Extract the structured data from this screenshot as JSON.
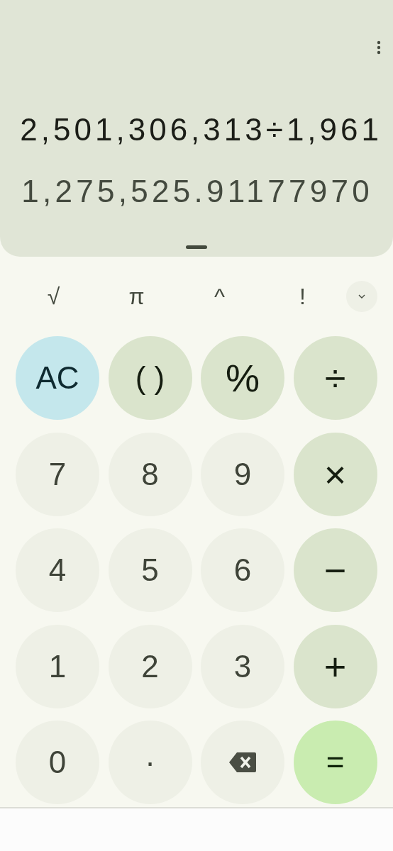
{
  "display": {
    "expression": "2,501,306,313÷1,961",
    "result": "1,275,525.91177970"
  },
  "scientific": {
    "keys": [
      "√",
      "π",
      "^",
      "!"
    ],
    "expanded": false
  },
  "keys": [
    {
      "label": "AC",
      "kind": "clear"
    },
    {
      "label": "( )",
      "kind": "function"
    },
    {
      "label": "%",
      "kind": "function"
    },
    {
      "label": "÷",
      "kind": "function"
    },
    {
      "label": "7",
      "kind": "digit"
    },
    {
      "label": "8",
      "kind": "digit"
    },
    {
      "label": "9",
      "kind": "digit"
    },
    {
      "label": "×",
      "kind": "function"
    },
    {
      "label": "4",
      "kind": "digit"
    },
    {
      "label": "5",
      "kind": "digit"
    },
    {
      "label": "6",
      "kind": "digit"
    },
    {
      "label": "−",
      "kind": "function"
    },
    {
      "label": "1",
      "kind": "digit"
    },
    {
      "label": "2",
      "kind": "digit"
    },
    {
      "label": "3",
      "kind": "digit"
    },
    {
      "label": "+",
      "kind": "function"
    },
    {
      "label": "0",
      "kind": "digit"
    },
    {
      "label": "·",
      "kind": "digit"
    },
    {
      "kind": "backspace"
    },
    {
      "label": "=",
      "kind": "equals"
    }
  ]
}
